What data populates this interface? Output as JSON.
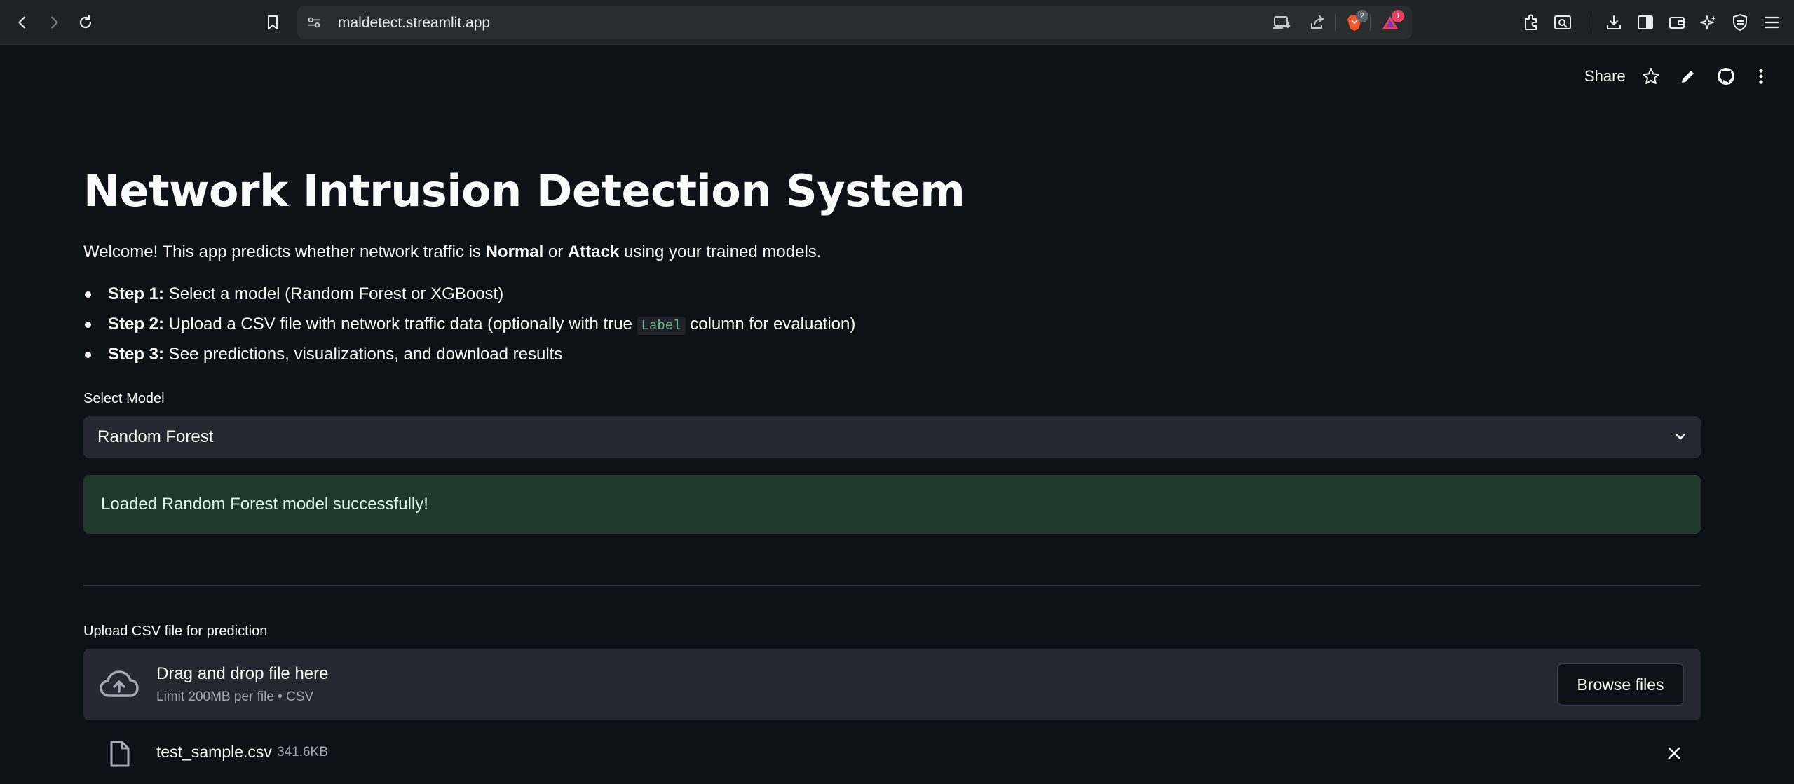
{
  "browser": {
    "url": "maldetect.streamlit.app",
    "brave_shield_count": "2",
    "rewards_count": "1"
  },
  "app_header": {
    "share_label": "Share"
  },
  "main": {
    "title": "Network Intrusion Detection System",
    "welcome": {
      "prefix": "Welcome! This app predicts whether network traffic is ",
      "normal": "Normal",
      "or": " or ",
      "attack": "Attack",
      "suffix": " using your trained models."
    },
    "steps": [
      {
        "bold": "Step 1:",
        "text": " Select a model (Random Forest or XGBoost)"
      },
      {
        "bold": "Step 2:",
        "text_before": " Upload a CSV file with network traffic data (optionally with true ",
        "code": "Label",
        "text_after": " column for evaluation)"
      },
      {
        "bold": "Step 3:",
        "text": " See predictions, visualizations, and download results"
      }
    ],
    "model_select": {
      "label": "Select Model",
      "value": "Random Forest"
    },
    "success_message": "Loaded Random Forest model successfully!",
    "uploader": {
      "label": "Upload CSV file for prediction",
      "drop_text": "Drag and drop file here",
      "limit_text": "Limit 200MB per file • CSV",
      "browse_label": "Browse files"
    },
    "uploaded_file": {
      "name": "test_sample.csv",
      "size": "341.6KB"
    }
  },
  "colors": {
    "background": "#0e1117",
    "widget": "#262730",
    "success_bg": "#1f3a2c",
    "code_text": "#6bb589"
  }
}
